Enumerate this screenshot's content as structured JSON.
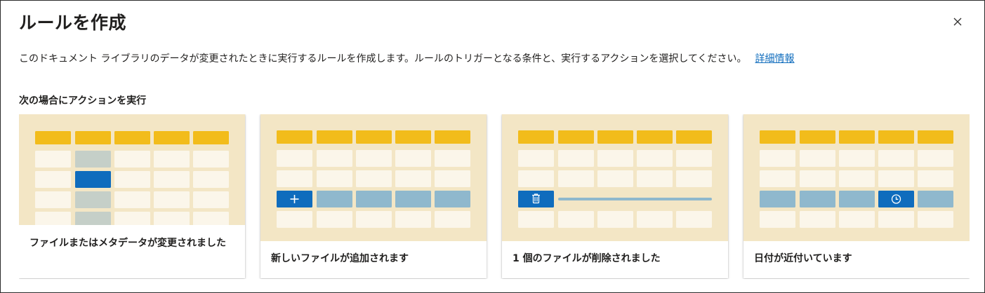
{
  "dialog": {
    "title": "ルールを作成",
    "close_icon": "close-icon",
    "description": "このドキュメント ライブラリのデータが変更されたときに実行するルールを作成します。ルールのトリガーとなる条件と、実行するアクションを選択してください。",
    "learn_more": "詳細情報",
    "section_label": "次の場合にアクションを実行"
  },
  "cards": [
    {
      "label": "ファイルまたはメタデータが変更されました",
      "icon": "cell-edit-icon"
    },
    {
      "label": "新しいファイルが追加されます",
      "icon": "plus-icon"
    },
    {
      "label": "1 個のファイルが削除されました",
      "icon": "trash-icon"
    },
    {
      "label": "日付が近付いています",
      "icon": "clock-icon"
    }
  ],
  "colors": {
    "header_cell": "#f2bc1b",
    "cell": "#fbf6ea",
    "illus_bg": "#f3e6c5",
    "highlight_cell": "#c5cfc8",
    "accent": "#0f6cbd",
    "row_highlight": "#8fb8cd",
    "link": "#0f6cbd"
  }
}
